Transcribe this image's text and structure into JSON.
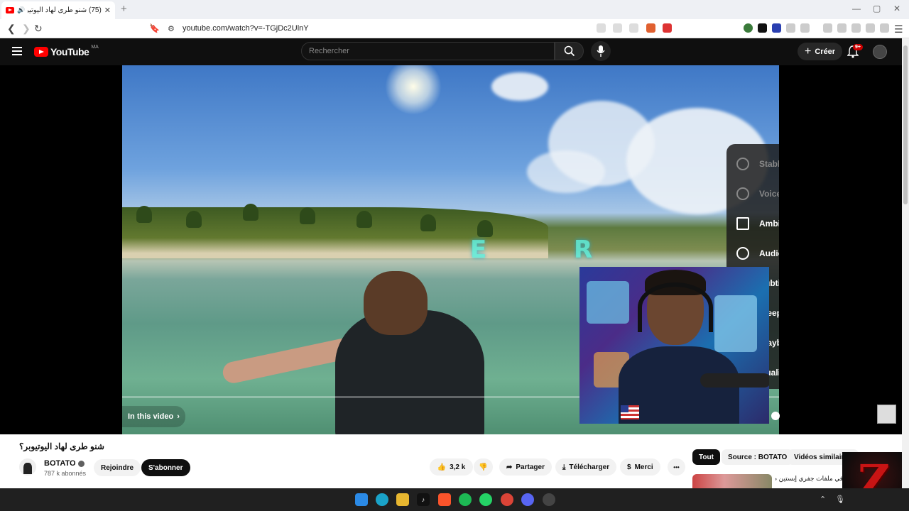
{
  "browser": {
    "tab_title": "(75) شنو طرى لهاد اليوتيوبر؟ -",
    "tab_close": "✕",
    "new_tab": "+",
    "url": "youtube.com/watch?v=-TGjDc2UlnY",
    "window_controls": [
      "—",
      "▢",
      "✕"
    ]
  },
  "youtube": {
    "logo_text": "YouTube",
    "country_code": "MA",
    "search_placeholder": "Rechercher",
    "create_label": "Créer",
    "notification_count": "9+"
  },
  "player": {
    "overlay_letters": [
      "E",
      "R"
    ],
    "in_this_video": "In this video",
    "settings_menu": [
      {
        "label": "Stable Volume",
        "icon": "stable-volume-icon",
        "dim": true
      },
      {
        "label": "Voice Boost",
        "icon": "voice-boost-icon",
        "dim": true
      },
      {
        "label": "Ambient mode",
        "icon": "ambient-icon",
        "dim": false
      },
      {
        "label": "Audio track",
        "icon": "audio-track-icon",
        "dim": false
      },
      {
        "label": "Subtitles",
        "icon": "subtitles-icon",
        "dim": false
      },
      {
        "label": "Sleep timer",
        "icon": "sleep-timer-icon",
        "dim": false
      },
      {
        "label": "Playback speed",
        "icon": "playback-speed-icon",
        "dim": false
      },
      {
        "label": "Quality",
        "icon": "quality-icon",
        "dim": false
      }
    ]
  },
  "video": {
    "title": "شنو طرى لهاد اليوتيوبر؟",
    "channel_name": "BOTATO",
    "subscribers": "787 k abonnés",
    "join_label": "Rejoindre",
    "subscribe_label": "S'abonner",
    "likes": "3,2 k",
    "share_label": "Partager",
    "download_label": "Télécharger",
    "thanks_label": "Merci",
    "more_label": "•••"
  },
  "recommendations": {
    "chips": [
      "Tout",
      "Source : BOTATO",
      "Vidéos similaires"
    ],
    "first_title": "في ملفات جفري إبستين صدمت"
  },
  "colors": {
    "youtube_red": "#ff0000",
    "masthead_bg": "#0f0f0f",
    "taskbar_bg": "#202020"
  }
}
